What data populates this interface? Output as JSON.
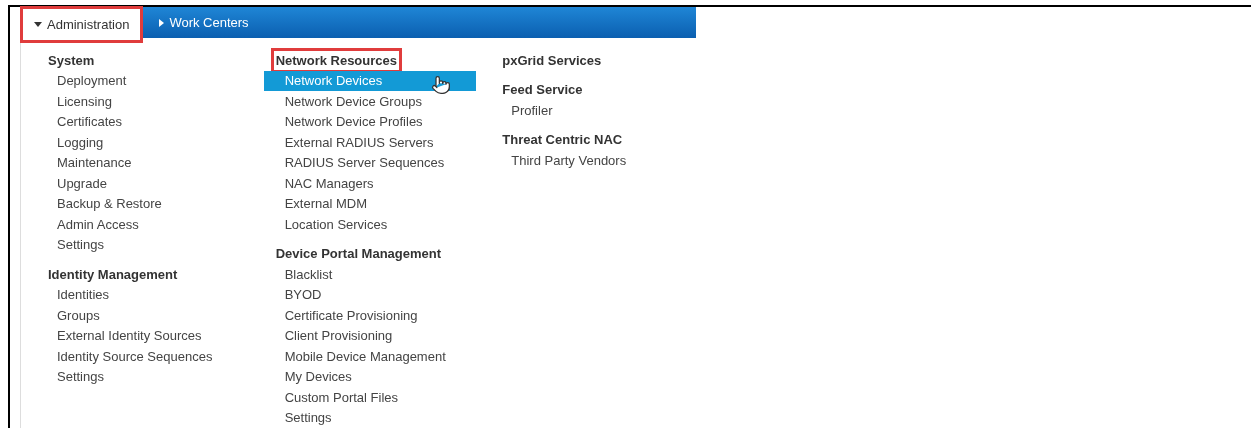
{
  "tabs": [
    {
      "label": "Administration",
      "selected": true,
      "expanded": true,
      "highlighted": true
    },
    {
      "label": "Work Centers",
      "selected": false,
      "expanded": false,
      "highlighted": false
    }
  ],
  "columns": [
    {
      "groups": [
        {
          "heading": "System",
          "highlighted": false,
          "items": [
            {
              "label": "Deployment",
              "selected": false
            },
            {
              "label": "Licensing",
              "selected": false
            },
            {
              "label": "Certificates",
              "selected": false
            },
            {
              "label": "Logging",
              "selected": false
            },
            {
              "label": "Maintenance",
              "selected": false
            },
            {
              "label": "Upgrade",
              "selected": false
            },
            {
              "label": "Backup & Restore",
              "selected": false
            },
            {
              "label": "Admin Access",
              "selected": false
            },
            {
              "label": "Settings",
              "selected": false
            }
          ]
        },
        {
          "heading": "Identity Management",
          "highlighted": false,
          "items": [
            {
              "label": "Identities",
              "selected": false
            },
            {
              "label": "Groups",
              "selected": false
            },
            {
              "label": "External Identity Sources",
              "selected": false
            },
            {
              "label": "Identity Source Sequences",
              "selected": false
            },
            {
              "label": "Settings",
              "selected": false
            }
          ]
        }
      ]
    },
    {
      "groups": [
        {
          "heading": "Network Resources",
          "highlighted": true,
          "items": [
            {
              "label": "Network Devices",
              "selected": true
            },
            {
              "label": "Network Device Groups",
              "selected": false
            },
            {
              "label": "Network Device Profiles",
              "selected": false
            },
            {
              "label": "External RADIUS Servers",
              "selected": false
            },
            {
              "label": "RADIUS Server Sequences",
              "selected": false
            },
            {
              "label": "NAC Managers",
              "selected": false
            },
            {
              "label": "External MDM",
              "selected": false
            },
            {
              "label": "Location Services",
              "selected": false
            }
          ]
        },
        {
          "heading": "Device Portal Management",
          "highlighted": false,
          "items": [
            {
              "label": "Blacklist",
              "selected": false
            },
            {
              "label": "BYOD",
              "selected": false
            },
            {
              "label": "Certificate Provisioning",
              "selected": false
            },
            {
              "label": "Client Provisioning",
              "selected": false
            },
            {
              "label": "Mobile Device Management",
              "selected": false
            },
            {
              "label": "My Devices",
              "selected": false
            },
            {
              "label": "Custom Portal Files",
              "selected": false
            },
            {
              "label": "Settings",
              "selected": false
            }
          ]
        }
      ]
    },
    {
      "groups": [
        {
          "heading": "pxGrid Services",
          "highlighted": false
        },
        {
          "heading": "Feed Service",
          "highlighted": false,
          "items": [
            {
              "label": "Profiler",
              "selected": false
            }
          ]
        },
        {
          "heading": "Threat Centric NAC",
          "highlighted": false,
          "items": [
            {
              "label": "Third Party Vendors",
              "selected": false
            }
          ]
        }
      ]
    }
  ]
}
